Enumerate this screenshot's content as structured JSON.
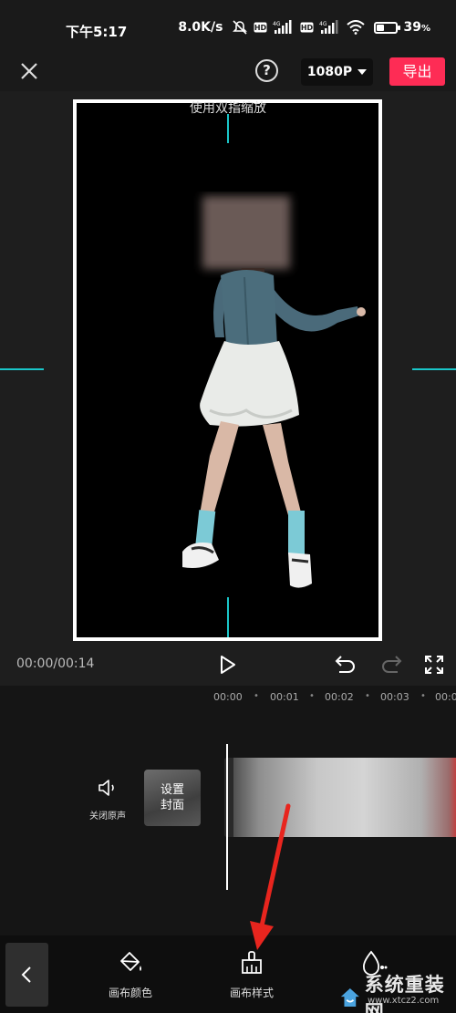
{
  "status_bar": {
    "time": "下午5:17",
    "network_speed": "8.0K/s",
    "battery_percent": "39",
    "battery_level": 0.39,
    "icons": [
      "mute-icon",
      "hd-icon",
      "signal-4g-icon",
      "hd-icon",
      "signal-4g-icon",
      "wifi-icon",
      "battery-icon"
    ]
  },
  "toolbar": {
    "help_label": "?",
    "resolution": "1080P",
    "export_label": "导出"
  },
  "preview": {
    "hint": "使用双指缩放"
  },
  "playback": {
    "timecode": "00:00/00:14"
  },
  "timeline": {
    "ruler": [
      "00:00",
      "00:01",
      "00:02",
      "00:03",
      "00:0"
    ],
    "audio_label": "关闭原声",
    "cover_label": "设置封面"
  },
  "bottom_tools": {
    "canvas_color": "画布颜色",
    "canvas_style": "画布样式"
  },
  "watermark": {
    "name": "系统重装网",
    "url": "www.xtcz2.com"
  },
  "colors": {
    "accent_export": "#fe2c55",
    "guide_line": "#1ac6c9",
    "annotation_arrow": "#e8251e"
  }
}
